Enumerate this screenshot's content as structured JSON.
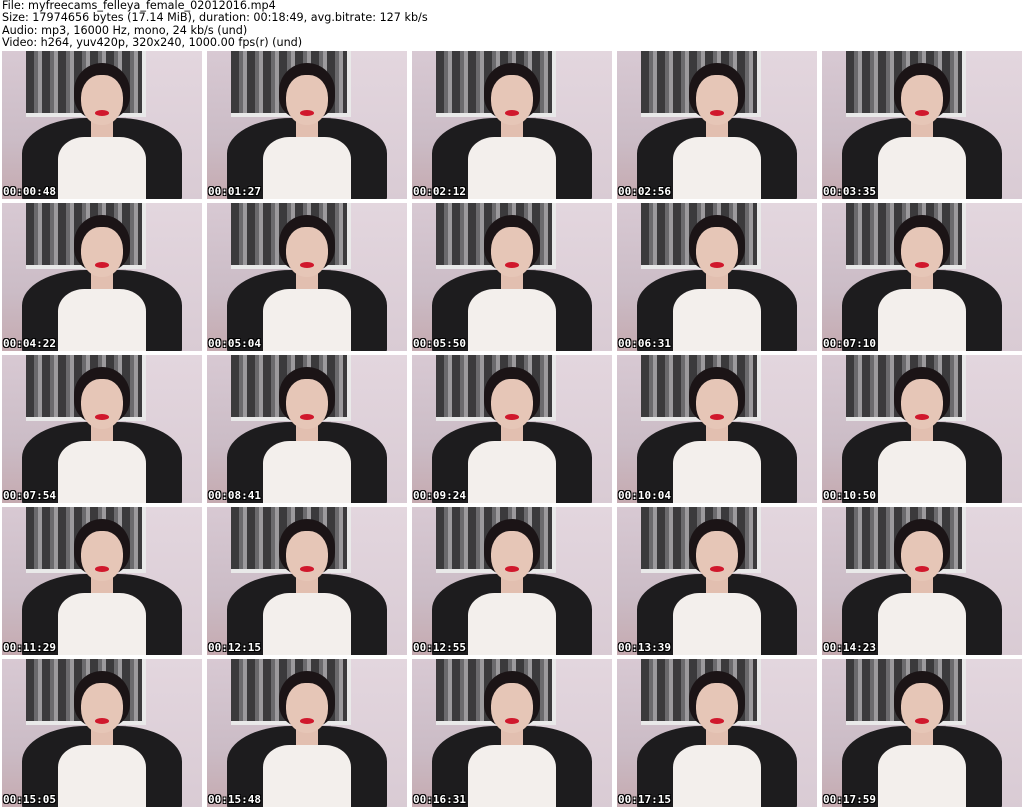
{
  "header": {
    "file": "File: myfreecams_felleya_female_02012016.mp4",
    "size": "Size: 17974656 bytes (17.14 MiB), duration: 00:18:49, avg.bitrate: 127 kb/s",
    "audio": "Audio: mp3, 16000 Hz, mono, 24 kb/s (und)",
    "video": "Video: h264, yuv420p, 320x240, 1000.00 fps(r) (und)"
  },
  "thumbnails": [
    {
      "timestamp": "00:00:48"
    },
    {
      "timestamp": "00:01:27"
    },
    {
      "timestamp": "00:02:12"
    },
    {
      "timestamp": "00:02:56"
    },
    {
      "timestamp": "00:03:35"
    },
    {
      "timestamp": "00:04:22"
    },
    {
      "timestamp": "00:05:04"
    },
    {
      "timestamp": "00:05:50"
    },
    {
      "timestamp": "00:06:31"
    },
    {
      "timestamp": "00:07:10"
    },
    {
      "timestamp": "00:07:54"
    },
    {
      "timestamp": "00:08:41"
    },
    {
      "timestamp": "00:09:24"
    },
    {
      "timestamp": "00:10:04"
    },
    {
      "timestamp": "00:10:50"
    },
    {
      "timestamp": "00:11:29"
    },
    {
      "timestamp": "00:12:15"
    },
    {
      "timestamp": "00:12:55"
    },
    {
      "timestamp": "00:13:39"
    },
    {
      "timestamp": "00:14:23"
    },
    {
      "timestamp": "00:15:05"
    },
    {
      "timestamp": "00:15:48"
    },
    {
      "timestamp": "00:16:31"
    },
    {
      "timestamp": "00:17:15"
    },
    {
      "timestamp": "00:17:59"
    }
  ]
}
